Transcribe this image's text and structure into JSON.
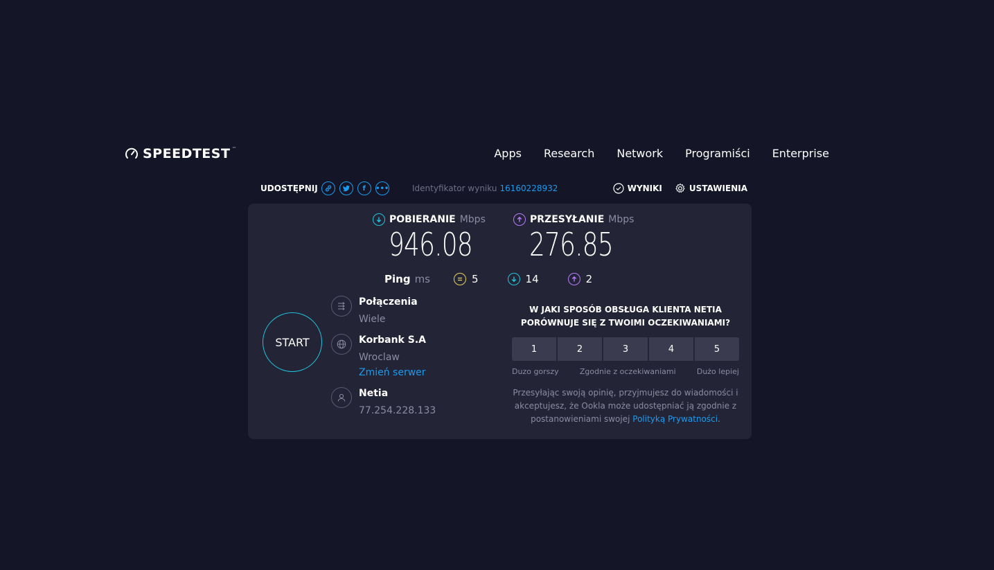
{
  "header": {
    "logo_text": "SPEEDTEST",
    "nav": [
      "Apps",
      "Research",
      "Network",
      "Programiści",
      "Enterprise"
    ]
  },
  "share": {
    "label": "UDOSTĘPNIJ",
    "result_id_label": "Identyfikator wyniku",
    "result_id": "16160228932",
    "results_label": "WYNIKI",
    "settings_label": "USTAWIENIA"
  },
  "download": {
    "label": "POBIERANIE",
    "unit": "Mbps",
    "value": "946.08"
  },
  "upload": {
    "label": "PRZESYŁANIE",
    "unit": "Mbps",
    "value": "276.85"
  },
  "ping": {
    "label": "Ping",
    "unit": "ms",
    "idle": "5",
    "download": "14",
    "upload": "2"
  },
  "start_label": "START",
  "connections": {
    "title": "Połączenia",
    "value": "Wiele"
  },
  "server": {
    "name": "Korbank S.A",
    "city": "Wroclaw",
    "change_label": "Zmień serwer"
  },
  "provider": {
    "name": "Netia",
    "ip": "77.254.228.133"
  },
  "survey": {
    "question": "W JAKI SPOSÓB OBSŁUGA KLIENTA NETIA PORÓWNUJE SIĘ Z TWOIMI OCZEKIWANIAMI?",
    "ratings": [
      "1",
      "2",
      "3",
      "4",
      "5"
    ],
    "low_label": "Duzo gorszy",
    "mid_label": "Zgodnie z oczekiwaniami",
    "high_label": "Dużo lepiej",
    "disclaimer": "Przesyłając swoją opinię, przyjmujesz do wiadomości i akceptujesz, że Ookla może udostępniać ją zgodnie z postanowieniami swojej",
    "privacy_link": "Polityką Prywatności",
    "period": "."
  },
  "colors": {
    "accent_blue": "#1a9cf0",
    "download": "#1fc6df",
    "upload": "#b57bff",
    "ping": "#e8d45c",
    "background": "#141526",
    "card": "#232435"
  }
}
